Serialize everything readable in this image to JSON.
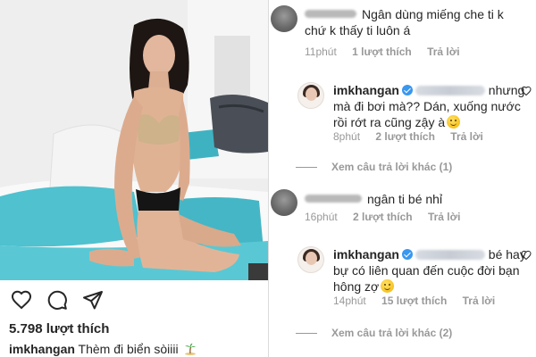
{
  "post": {
    "likes": "5.798 lượt thích",
    "caption": {
      "username": "imkhangan",
      "text": "Thèm đi biển sòiiii"
    }
  },
  "comments": [
    {
      "id": "c1",
      "username_hidden": true,
      "text": "Ngân dùng miếng che ti k chứ k thấy ti luôn á",
      "time": "11phút",
      "likes": "1 lượt thích",
      "reply": "Trả lời"
    },
    {
      "id": "c2",
      "username": "imkhangan",
      "verified": true,
      "text": "nhưng mà đi bơi mà?? Dán, xuống nước rồi rớt ra cũng zậy à",
      "time": "8phút",
      "likes": "2 lượt thích",
      "reply": "Trả lời"
    },
    {
      "id": "c3",
      "username_hidden": true,
      "text": "ngân ti bé nhỉ",
      "time": "16phút",
      "likes": "2 lượt thích",
      "reply": "Trả lời"
    },
    {
      "id": "c4",
      "username": "imkhangan",
      "verified": true,
      "text": "bé hay bự có liên quan đến cuộc đời bạn hông zợ",
      "time": "14phút",
      "likes": "15 lượt thích",
      "reply": "Trả lời"
    }
  ],
  "more_replies": [
    {
      "text": "Xem câu trả lời khác (1)"
    },
    {
      "text": "Xem câu trả lời khác (2)"
    }
  ],
  "icons": {
    "heart": "heart-icon",
    "comment": "comment-icon",
    "share": "share-icon",
    "palm_tree": "palm-tree-emoji",
    "smile": "smile-emoji",
    "verified": "verified-badge-icon"
  },
  "colors": {
    "text": "#262626",
    "meta": "#999999",
    "verified": "#3897f0",
    "divider": "#dbdbdb"
  }
}
